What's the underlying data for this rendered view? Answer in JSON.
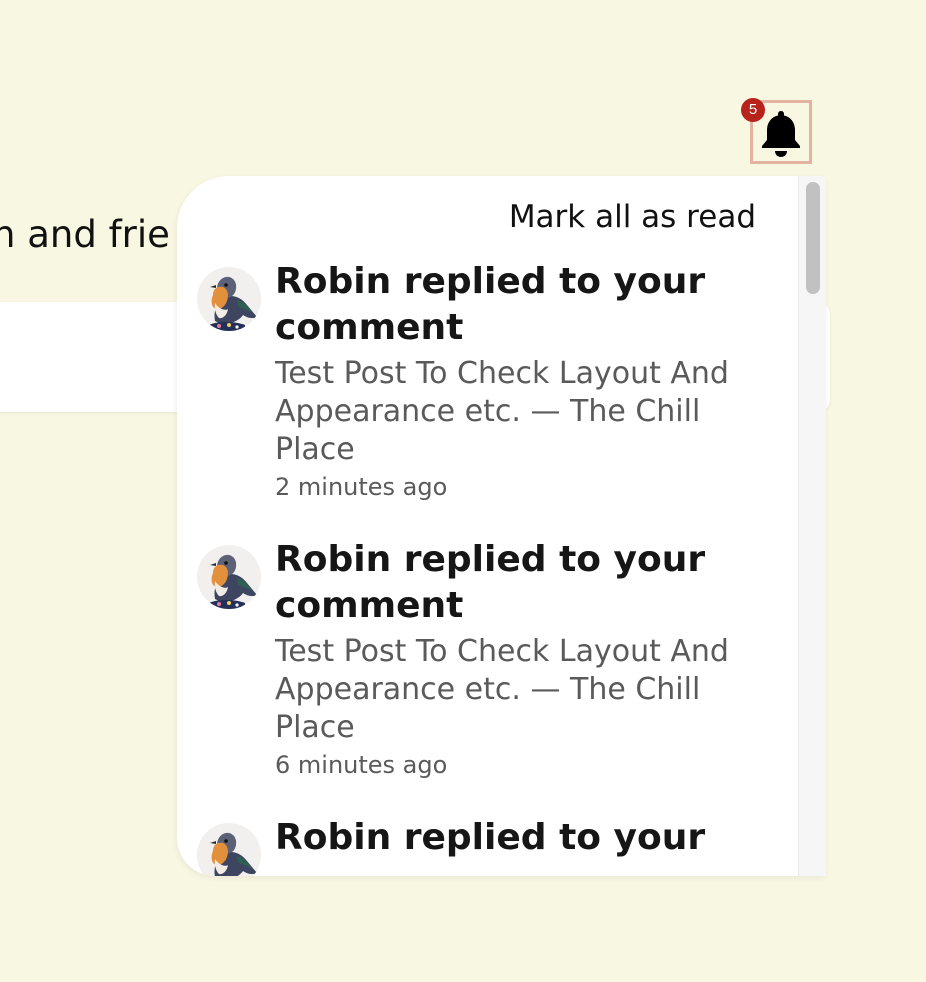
{
  "background": {
    "visible_text": "n and frie"
  },
  "notifications_button": {
    "icon": "bell-icon",
    "badge_count": "5",
    "badge_color": "#b7231c",
    "focus_border_color": "#e2b3a2"
  },
  "dropdown": {
    "mark_all_label": "Mark all as read",
    "items": [
      {
        "avatar_icon": "robin-bird-avatar",
        "title": "Robin replied to your comment",
        "subtitle": "Test Post To Check Layout And Appearance etc. — The Chill Place",
        "time": "2 minutes ago"
      },
      {
        "avatar_icon": "robin-bird-avatar",
        "title": "Robin replied to your comment",
        "subtitle": "Test Post To Check Layout And Appearance etc. — The Chill Place",
        "time": "6 minutes ago"
      },
      {
        "avatar_icon": "robin-bird-avatar",
        "title": "Robin replied to your",
        "subtitle": "",
        "time": ""
      }
    ]
  },
  "colors": {
    "page_background": "#f8f7e2",
    "panel_background": "#ffffff",
    "secondary_text": "#5a5a5a"
  }
}
